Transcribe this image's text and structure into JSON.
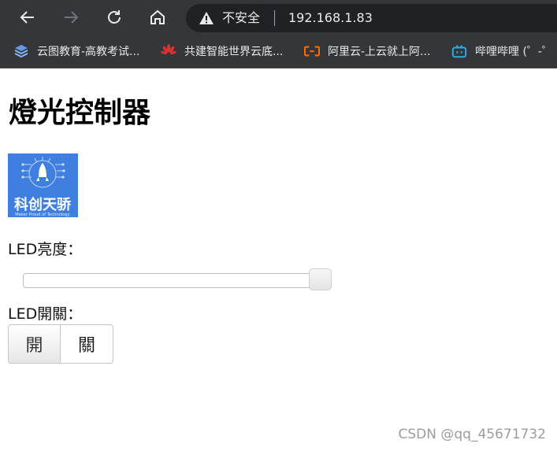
{
  "browser": {
    "security_label": "不安全",
    "url": "192.168.1.83",
    "bookmarks": [
      {
        "label": "云图教育-高教考试...",
        "icon": "cloud-stack-icon"
      },
      {
        "label": "共建智能世界云底...",
        "icon": "huawei-icon"
      },
      {
        "label": "阿里云-上云就上阿...",
        "icon": "aliyun-icon"
      },
      {
        "label": "哔哩哔哩 (゜-゜",
        "icon": "bilibili-icon"
      }
    ]
  },
  "page": {
    "title": "燈光控制器",
    "logo_text": "科创天骄",
    "logo_subtext": "Maker Proud of Technology",
    "brightness_label": "LED亮度：",
    "brightness_value": 1.0,
    "switch_label": "LED開關：",
    "on_label": "開",
    "off_label": "關",
    "watermark": "CSDN @qq_45671732"
  },
  "colors": {
    "chrome_bg": "#35363a",
    "omnibox_bg": "#202124",
    "logo_bg": "#3f7fe0"
  }
}
